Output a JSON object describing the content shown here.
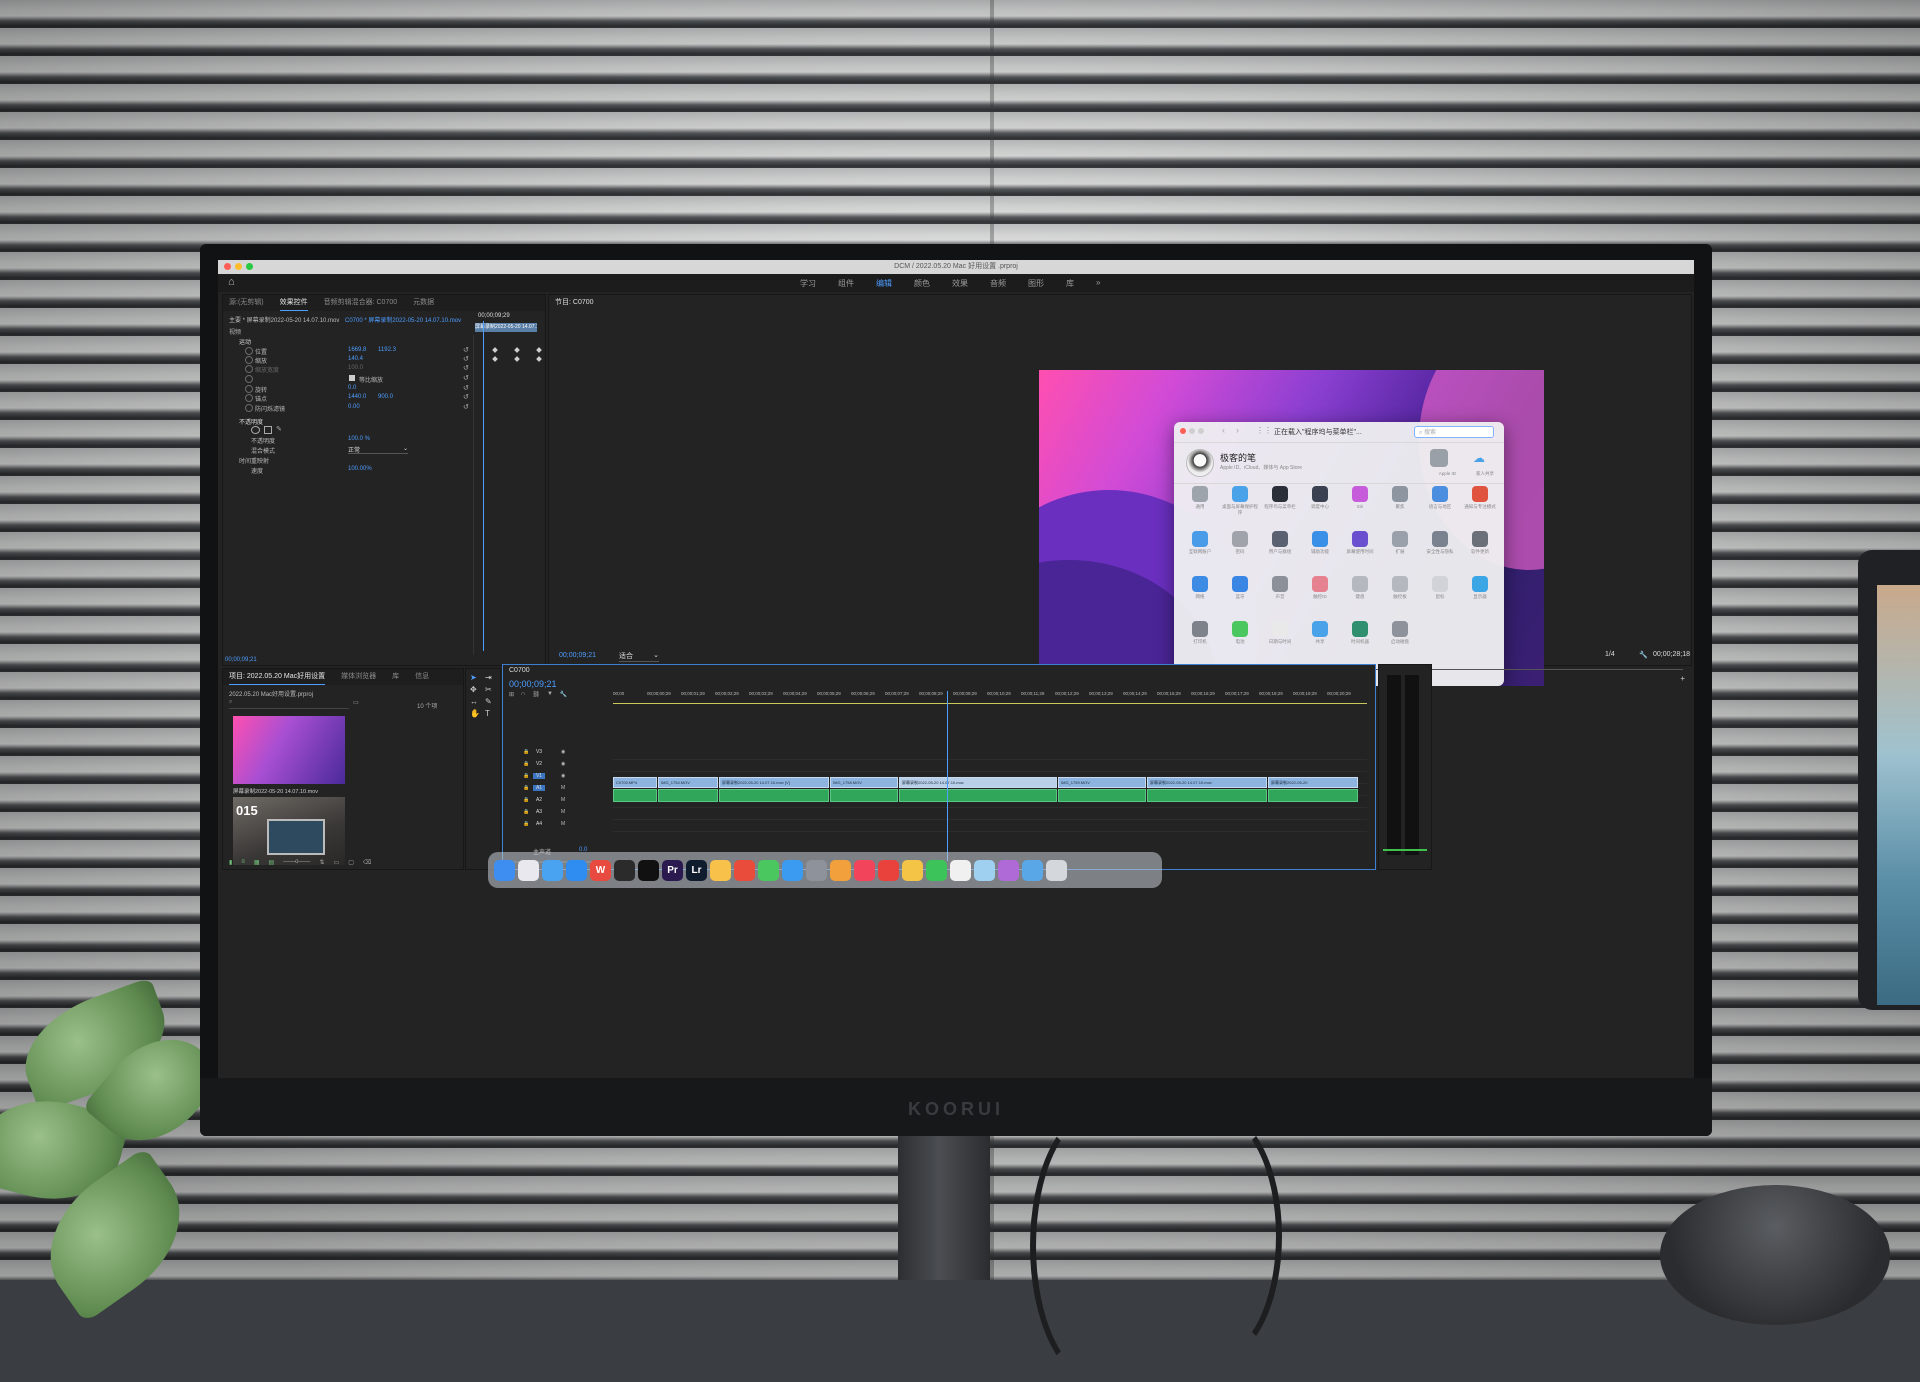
{
  "monitor": {
    "brand": "KOORUI"
  },
  "app": {
    "title": "DCM / 2022.05.20 Mac 好用设置 .prproj",
    "workspace_tabs": [
      {
        "label": "学习",
        "active": false
      },
      {
        "label": "组件",
        "active": false
      },
      {
        "label": "编辑",
        "active": true
      },
      {
        "label": "颜色",
        "active": false
      },
      {
        "label": "效果",
        "active": false
      },
      {
        "label": "音频",
        "active": false
      },
      {
        "label": "图形",
        "active": false
      },
      {
        "label": "库",
        "active": false
      },
      {
        "label": "»",
        "active": false
      }
    ]
  },
  "effect_controls": {
    "tabs": [
      "源:(无剪辑)",
      "效果控件",
      "音频剪辑混合器: C0700",
      "元数据"
    ],
    "active_tab": "效果控件",
    "source_path": "主要 * 屏幕录制2022-05-20 14.07.10.mov",
    "sequence_path": "C0700 * 屏幕录制2022-05-20 14.07.10.mov",
    "timecode_top": "00;00;09;29",
    "clip_label": "屏幕录制2022-05-20 14.07.10...",
    "section_video": "视频",
    "motion": "运动",
    "rows": [
      {
        "label": "位置",
        "v1": "1669.8",
        "v2": "1192.3"
      },
      {
        "label": "缩放",
        "v1": "140.4",
        "v2": ""
      },
      {
        "label": "缩放宽度",
        "v1": "100.0",
        "v2": ""
      },
      {
        "label": "等比缩放",
        "v1": "",
        "v2": ""
      },
      {
        "label": "旋转",
        "v1": "0.0",
        "v2": ""
      },
      {
        "label": "锚点",
        "v1": "1440.0",
        "v2": "900.0"
      },
      {
        "label": "防闪烁滤镜",
        "v1": "0.00",
        "v2": ""
      }
    ],
    "opacity_section": "不透明度",
    "opacity_row": {
      "label": "不透明度",
      "v1": "100.0 %"
    },
    "blend_row": {
      "label": "混合模式",
      "v1": "正常"
    },
    "time_remap": "时间重映射",
    "speed_row": {
      "label": "速度",
      "v1": "100.00%"
    },
    "timecode_bottom": "00;00;09;21"
  },
  "program": {
    "tab": "节目: C0700",
    "timecode_current": "00;00;09;21",
    "fit_label": "适合",
    "quality": "1/4",
    "timecode_total": "00;00;28;18"
  },
  "system_prefs": {
    "title": "正在载入\"程序坞与菜单栏\"...",
    "search_placeholder": "搜索",
    "user_name": "极客的笔",
    "user_sub": "Apple ID、iCloud、媒体与 App Store",
    "top_right": [
      "Apple ID",
      "家人共享"
    ],
    "items": [
      {
        "label": "通用",
        "color": "#9ea4ab"
      },
      {
        "label": "桌面与屏幕保护程序",
        "color": "#4aa3e8"
      },
      {
        "label": "程序坞与菜单栏",
        "color": "#2b2f38"
      },
      {
        "label": "调度中心",
        "color": "#3b4150"
      },
      {
        "label": "Siri",
        "color": "#c65cd9"
      },
      {
        "label": "聚焦",
        "color": "#8d96a0"
      },
      {
        "label": "语言与地区",
        "color": "#4b8ee0"
      },
      {
        "label": "通知与专注模式",
        "color": "#e0533f"
      },
      {
        "label": "互联网账户",
        "color": "#4a9be8"
      },
      {
        "label": "密码",
        "color": "#a0a4aa"
      },
      {
        "label": "用户与群组",
        "color": "#5a6170"
      },
      {
        "label": "辅助功能",
        "color": "#3a8fe6"
      },
      {
        "label": "屏幕使用时间",
        "color": "#6a4fcf"
      },
      {
        "label": "扩展",
        "color": "#9aa1aa"
      },
      {
        "label": "安全性与隐私",
        "color": "#7a8290"
      },
      {
        "label": "软件更新",
        "color": "#6a6f78"
      },
      {
        "label": "网络",
        "color": "#3c8be4"
      },
      {
        "label": "蓝牙",
        "color": "#3a86e4"
      },
      {
        "label": "声音",
        "color": "#8b9099"
      },
      {
        "label": "触控ID",
        "color": "#e6828f"
      },
      {
        "label": "键盘",
        "color": "#b5b9bf"
      },
      {
        "label": "触控板",
        "color": "#b5b9bf"
      },
      {
        "label": "鼠标",
        "color": "#d0d3d7"
      },
      {
        "label": "显示器",
        "color": "#3aa6e6"
      },
      {
        "label": "打印机",
        "color": "#7d828b"
      },
      {
        "label": "电池",
        "color": "#4bc760"
      },
      {
        "label": "日期与时间",
        "color": "#e9e9e9"
      },
      {
        "label": "共享",
        "color": "#4aa3e8"
      },
      {
        "label": "时间机器",
        "color": "#2f8f6e"
      },
      {
        "label": "启动磁盘",
        "color": "#8d929b"
      }
    ]
  },
  "project": {
    "tabs": [
      "项目: 2022.05.20 Mac好用设置",
      "媒体浏览器",
      "库",
      "信息"
    ],
    "file": "2022.05.20 Mac好用设置.prproj",
    "count": "10 个项",
    "clip1": "屏幕录制2022-05-20 14.07.10.mov",
    "clip2_badge": "015"
  },
  "timeline": {
    "tab": "C0700",
    "timecode": "00;00;09;21",
    "ruler": [
      "00;00",
      "00;00;00;29",
      "00;00;01;29",
      "00;00;02;29",
      "00;00;03;29",
      "00;00;04;29",
      "00;00;05;29",
      "00;00;06;29",
      "00;00;07;29",
      "00;00;08;29",
      "00;00;09;29",
      "00;00;10;29",
      "00;00;11;29",
      "00;00;12;29",
      "00;00;13;29",
      "00;00;14;29",
      "00;00;15;29",
      "00;00;16;29",
      "00;00;17;29",
      "00;00;18;29",
      "00;00;19;29",
      "00;00;20;29"
    ],
    "tracks_video": [
      "V3",
      "V2",
      "V1"
    ],
    "tracks_audio": [
      "A1",
      "A2",
      "A3",
      "A4"
    ],
    "master": "主声道",
    "master_val": "0.0",
    "v1_clips": [
      "C0700.MP4",
      "IMG_1754.MOV",
      "屏幕录制2022-05-20 14.07.10.mov [V]",
      "IMG_1758.MOV",
      "屏幕录制2022-05-20 14.07.10.mov",
      "IMG_1759.MOV",
      "屏幕录制2022-05-20 14.07.10.mov",
      "屏幕录制2022-05-20"
    ]
  },
  "dock": {
    "items": [
      {
        "name": "finder-icon",
        "color": "#3d8ef0",
        "text": ""
      },
      {
        "name": "launchpad-icon",
        "color": "#e8e8ee",
        "text": ""
      },
      {
        "name": "mail-icon",
        "color": "#4aa3f0",
        "text": ""
      },
      {
        "name": "appstore-icon",
        "color": "#2f8cf0",
        "text": ""
      },
      {
        "name": "wps-icon",
        "color": "#e94a3f",
        "text": "W"
      },
      {
        "name": "final-cut-icon",
        "color": "#2b2b2b",
        "text": ""
      },
      {
        "name": "capcut-icon",
        "color": "#111111",
        "text": ""
      },
      {
        "name": "premiere-icon",
        "color": "#2a1a4f",
        "text": "Pr"
      },
      {
        "name": "lightroom-icon",
        "color": "#0f1c2e",
        "text": "Lr"
      },
      {
        "name": "reminders-icon",
        "color": "#f7c14a",
        "text": ""
      },
      {
        "name": "infuse-icon",
        "color": "#e94c3a",
        "text": ""
      },
      {
        "name": "messages-icon",
        "color": "#4bc760",
        "text": ""
      },
      {
        "name": "safari-icon",
        "color": "#3a9bf0",
        "text": ""
      },
      {
        "name": "settings-icon",
        "color": "#8d929b",
        "text": ""
      },
      {
        "name": "photos-icon",
        "color": "#f2a03c",
        "text": ""
      },
      {
        "name": "music-icon",
        "color": "#f2445a",
        "text": ""
      },
      {
        "name": "weibo-icon",
        "color": "#e9423c",
        "text": ""
      },
      {
        "name": "chrome-icon",
        "color": "#f3c445",
        "text": ""
      },
      {
        "name": "wechat-icon",
        "color": "#3cc45a",
        "text": ""
      },
      {
        "name": "qq-icon",
        "color": "#f0f0f0",
        "text": ""
      },
      {
        "name": "preview-icon",
        "color": "#9fd0f0",
        "text": ""
      },
      {
        "name": "iina-icon",
        "color": "#b06ad8",
        "text": ""
      },
      {
        "name": "downloads-folder-icon",
        "color": "#5aa7e8",
        "text": ""
      },
      {
        "name": "trash-icon",
        "color": "#d4d7dc",
        "text": ""
      }
    ]
  }
}
